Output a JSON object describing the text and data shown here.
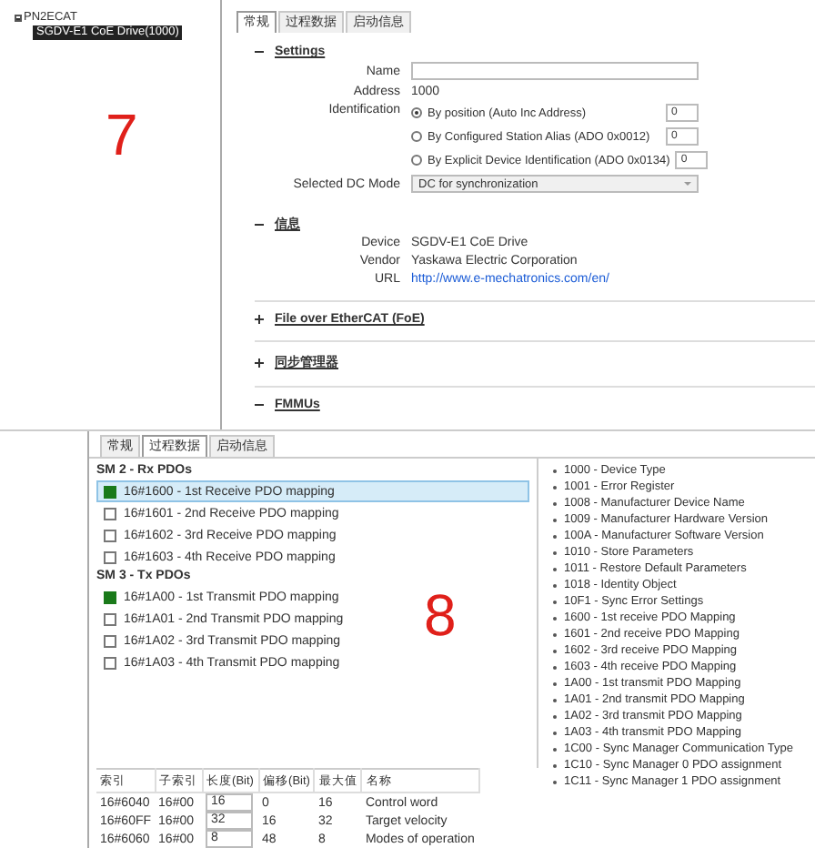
{
  "top_panel": {
    "tree": {
      "label": "PN2ECAT",
      "expanded": true,
      "children": [
        {
          "label": "SGDV-E1 CoE Drive(1000)",
          "selected": true
        }
      ]
    },
    "marker": "7",
    "tabs": [
      {
        "label": "常规",
        "selected": true
      },
      {
        "label": "过程数据",
        "selected": false
      },
      {
        "label": "启动信息",
        "selected": false
      }
    ],
    "settings": {
      "title": "Settings",
      "expanded": true,
      "name_label": "Name",
      "address_label": "Address",
      "address": "1000",
      "identification_label": "Identification",
      "identification": [
        {
          "label": "By position (Auto Inc Address)",
          "selected": true,
          "value": "0"
        },
        {
          "label": "By Configured Station Alias (ADO 0x0012)",
          "selected": false,
          "value": "0"
        },
        {
          "label": "By Explicit Device Identification (ADO 0x0134)",
          "selected": false,
          "value": "0"
        }
      ],
      "dc_mode_label": "Selected DC Mode",
      "dc_mode": "DC for synchronization"
    },
    "info": {
      "title": "信息",
      "expanded": true,
      "rows": [
        {
          "label": "Device",
          "value": "SGDV-E1 CoE Drive",
          "kind": "text"
        },
        {
          "label": "Vendor",
          "value": "Yaskawa Electric Corporation",
          "kind": "text"
        },
        {
          "label": "URL",
          "value": "http://www.e-mechatronics.com/en/",
          "kind": "link"
        }
      ]
    },
    "sections": [
      {
        "title": "File over EtherCAT (FoE)",
        "expanded": false
      },
      {
        "title": "同步管理器",
        "expanded": false
      },
      {
        "title": "FMMUs",
        "expanded": true
      }
    ]
  },
  "bottom_panel": {
    "tabs": [
      {
        "label": "常规",
        "selected": false
      },
      {
        "label": "过程数据",
        "selected": true
      },
      {
        "label": "启动信息",
        "selected": false
      }
    ],
    "marker": "8",
    "pdo_groups": [
      {
        "title": "SM 2 - Rx PDOs",
        "items": [
          {
            "label": "16#1600 - 1st Receive PDO mapping",
            "checked": true,
            "selected": true
          },
          {
            "label": "16#1601 - 2nd Receive PDO mapping",
            "checked": false,
            "selected": false
          },
          {
            "label": "16#1602 - 3rd Receive PDO mapping",
            "checked": false,
            "selected": false
          },
          {
            "label": "16#1603 - 4th Receive PDO mapping",
            "checked": false,
            "selected": false
          }
        ]
      },
      {
        "title": "SM 3 - Tx PDOs",
        "items": [
          {
            "label": "16#1A00 - 1st Transmit PDO mapping",
            "checked": true,
            "selected": false
          },
          {
            "label": "16#1A01 - 2nd Transmit PDO mapping",
            "checked": false,
            "selected": false
          },
          {
            "label": "16#1A02 - 3rd Transmit PDO mapping",
            "checked": false,
            "selected": false
          },
          {
            "label": "16#1A03 - 4th Transmit PDO mapping",
            "checked": false,
            "selected": false
          }
        ]
      }
    ],
    "objects": [
      "1000 - Device Type",
      "1001 - Error Register",
      "1008 - Manufacturer Device Name",
      "1009 - Manufacturer Hardware Version",
      "100A - Manufacturer Software Version",
      "1010 - Store Parameters",
      "1011 - Restore Default Parameters",
      "1018 - Identity Object",
      "10F1 - Sync Error Settings",
      "1600 - 1st receive PDO Mapping",
      "1601 - 2nd receive PDO Mapping",
      "1602 - 3rd receive PDO Mapping",
      "1603 - 4th receive PDO Mapping",
      "1A00 - 1st transmit PDO Mapping",
      "1A01 - 2nd transmit PDO Mapping",
      "1A02 - 3rd transmit PDO Mapping",
      "1A03 - 4th transmit PDO Mapping",
      "1C00 - Sync Manager Communication Type",
      "1C10 - Sync Manager 0 PDO assignment",
      "1C11 - Sync Manager 1 PDO assignment"
    ],
    "table": {
      "columns": [
        "索引",
        "子索引",
        "长度(Bit)",
        "偏移(Bit)",
        "最大值",
        "名称"
      ],
      "rows": [
        [
          "16#6040",
          "16#00",
          "16",
          "0",
          "16",
          "Control word"
        ],
        [
          "16#60FF",
          "16#00",
          "32",
          "16",
          "32",
          "Target velocity"
        ],
        [
          "16#6060",
          "16#00",
          "8",
          "48",
          "8",
          "Modes of operation"
        ]
      ]
    }
  }
}
